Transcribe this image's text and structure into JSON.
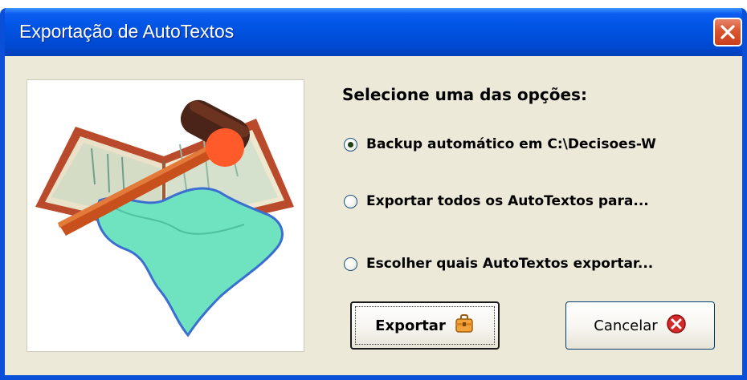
{
  "window": {
    "title": "Exportação de AutoTextos",
    "close_icon": "close-icon"
  },
  "heading": "Selecione uma das opções:",
  "options": [
    {
      "label": "Backup automático em C:\\Decisoes-W",
      "selected": true
    },
    {
      "label": "Exportar todos os AutoTextos para...",
      "selected": false
    },
    {
      "label": "Escolher quais AutoTextos exportar...",
      "selected": false
    }
  ],
  "buttons": {
    "export": {
      "label": "Exportar",
      "icon": "briefcase-icon"
    },
    "cancel": {
      "label": "Cancelar",
      "icon": "cancel-x-icon"
    }
  },
  "colors": {
    "titlebar": "#0054e3",
    "window_background": "#ece9d8",
    "close_button": "#d9552f",
    "cancel_icon": "#d42a2a"
  }
}
